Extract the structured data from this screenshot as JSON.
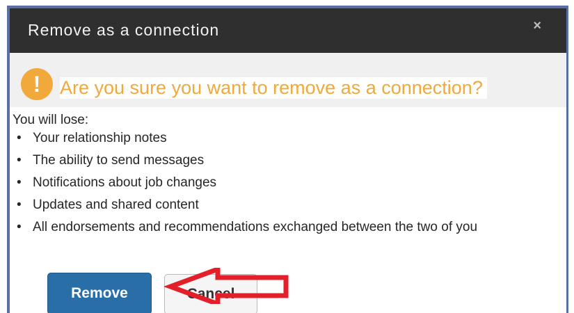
{
  "dialog": {
    "title": "Remove as a connection",
    "close_icon": "×",
    "warning_icon": "!",
    "warning_text": "Are you sure you want to remove as a connection?",
    "lose_label": "You will lose:",
    "items": [
      "Your relationship notes",
      "The ability to send messages",
      "Notifications about job changes",
      "Updates and shared content",
      "All endorsements and recommendations exchanged between the two of you"
    ],
    "remove_label": "Remove",
    "cancel_label": "Cancel"
  },
  "colors": {
    "titlebar": "#2f2f2f",
    "warning": "#f0a93a",
    "primary_button": "#2a6ea7",
    "annotation_arrow": "#e3202a"
  }
}
